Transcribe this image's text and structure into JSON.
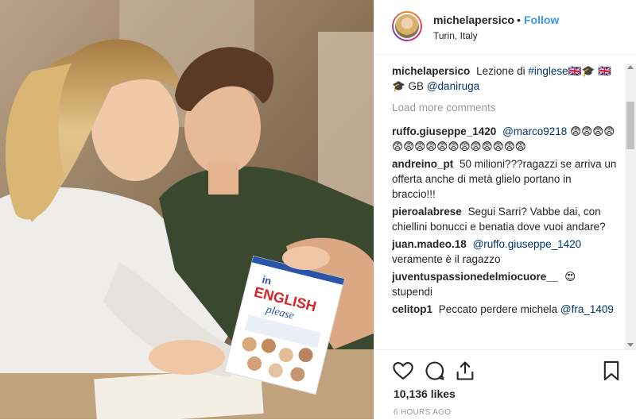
{
  "header": {
    "username": "michelapersico",
    "dot": "•",
    "follow_label": "Follow",
    "location": "Turin, Italy"
  },
  "caption": {
    "username": "michelapersico",
    "text": "Lezione di",
    "hashtag": "#inglese🇬🇧🎓",
    "text2": "🇬🇧🎓 GB",
    "mention": "@daniruga"
  },
  "load_more": "Load more comments",
  "comments": [
    {
      "user": "ruffo.giuseppe_1420",
      "mention": "@marco9218",
      "text": "😨😨😨😨😨😨😨😨😨😨😨😨😨😨😨😨"
    },
    {
      "user": "andreino_pt",
      "mention": "",
      "text": "50 milioni???ragazzi se arriva un offerta anche di metà glielo portano in braccio!!!"
    },
    {
      "user": "pieroalabrese",
      "mention": "",
      "text": "Segui Sarri? Vabbe dai, con chiellini bonucci e benatia dove vuoi andare?"
    },
    {
      "user": "juan.madeo.18",
      "mention": "@ruffo.giuseppe_1420",
      "text": "veramente è il ragazzo"
    },
    {
      "user": "juventuspassionedelmiocuore__",
      "mention": "",
      "text": "😍 stupendi"
    },
    {
      "user": "celitop1",
      "mention": "",
      "text": "Peccato perdere michela"
    },
    {
      "user": "",
      "mention": "@fra_1409",
      "text": ""
    }
  ],
  "icons": [
    "heart-icon",
    "comment-icon",
    "share-icon",
    "bookmark-icon"
  ],
  "likes": "10,136 likes",
  "time": "6 HOURS AGO",
  "book": {
    "title_in": "in",
    "title_english": "ENGLISH",
    "title_please": "please"
  },
  "colors": {
    "follow": "#3897f0",
    "mention": "#003569",
    "book_red": "#d8252c",
    "book_blue": "#2a55a7"
  }
}
